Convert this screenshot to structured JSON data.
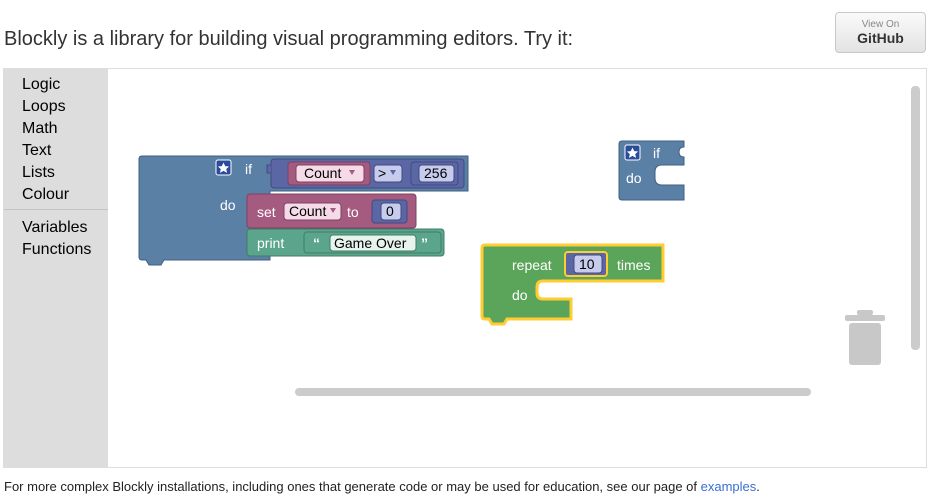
{
  "header": {
    "headline": "Blockly is a library for building visual programming editors. Try it:",
    "github_button": {
      "small": "View On",
      "big": "GitHub"
    }
  },
  "toolbox": {
    "items": [
      "Logic",
      "Loops",
      "Math",
      "Text",
      "Lists",
      "Colour",
      "Variables",
      "Functions"
    ]
  },
  "blocks": {
    "if_block": {
      "if_label": "if",
      "do_label": "do"
    },
    "compare": {
      "variable": "Count",
      "operator": ">",
      "value": "256"
    },
    "set_block": {
      "set_label": "set",
      "variable": "Count",
      "to_label": "to",
      "value": "0"
    },
    "print_block": {
      "print_label": "print",
      "open_quote": "“",
      "text": "Game Over",
      "close_quote": "”"
    },
    "small_if": {
      "if_label": "if",
      "do_label": "do"
    },
    "repeat_block": {
      "repeat_label": "repeat",
      "count": "10",
      "times_label": "times",
      "do_label": "do"
    }
  },
  "colors": {
    "logic": "#5b80a5",
    "variables": "#a55b80",
    "text": "#5ba58c",
    "loops": "#5ba55b",
    "math": "#5b67a5",
    "selected_outline": "#fc3"
  },
  "footer": {
    "text": "For more complex Blockly installations, including ones that generate code or may be used for education, see our page of",
    "link_text": "examples",
    "period": "."
  }
}
